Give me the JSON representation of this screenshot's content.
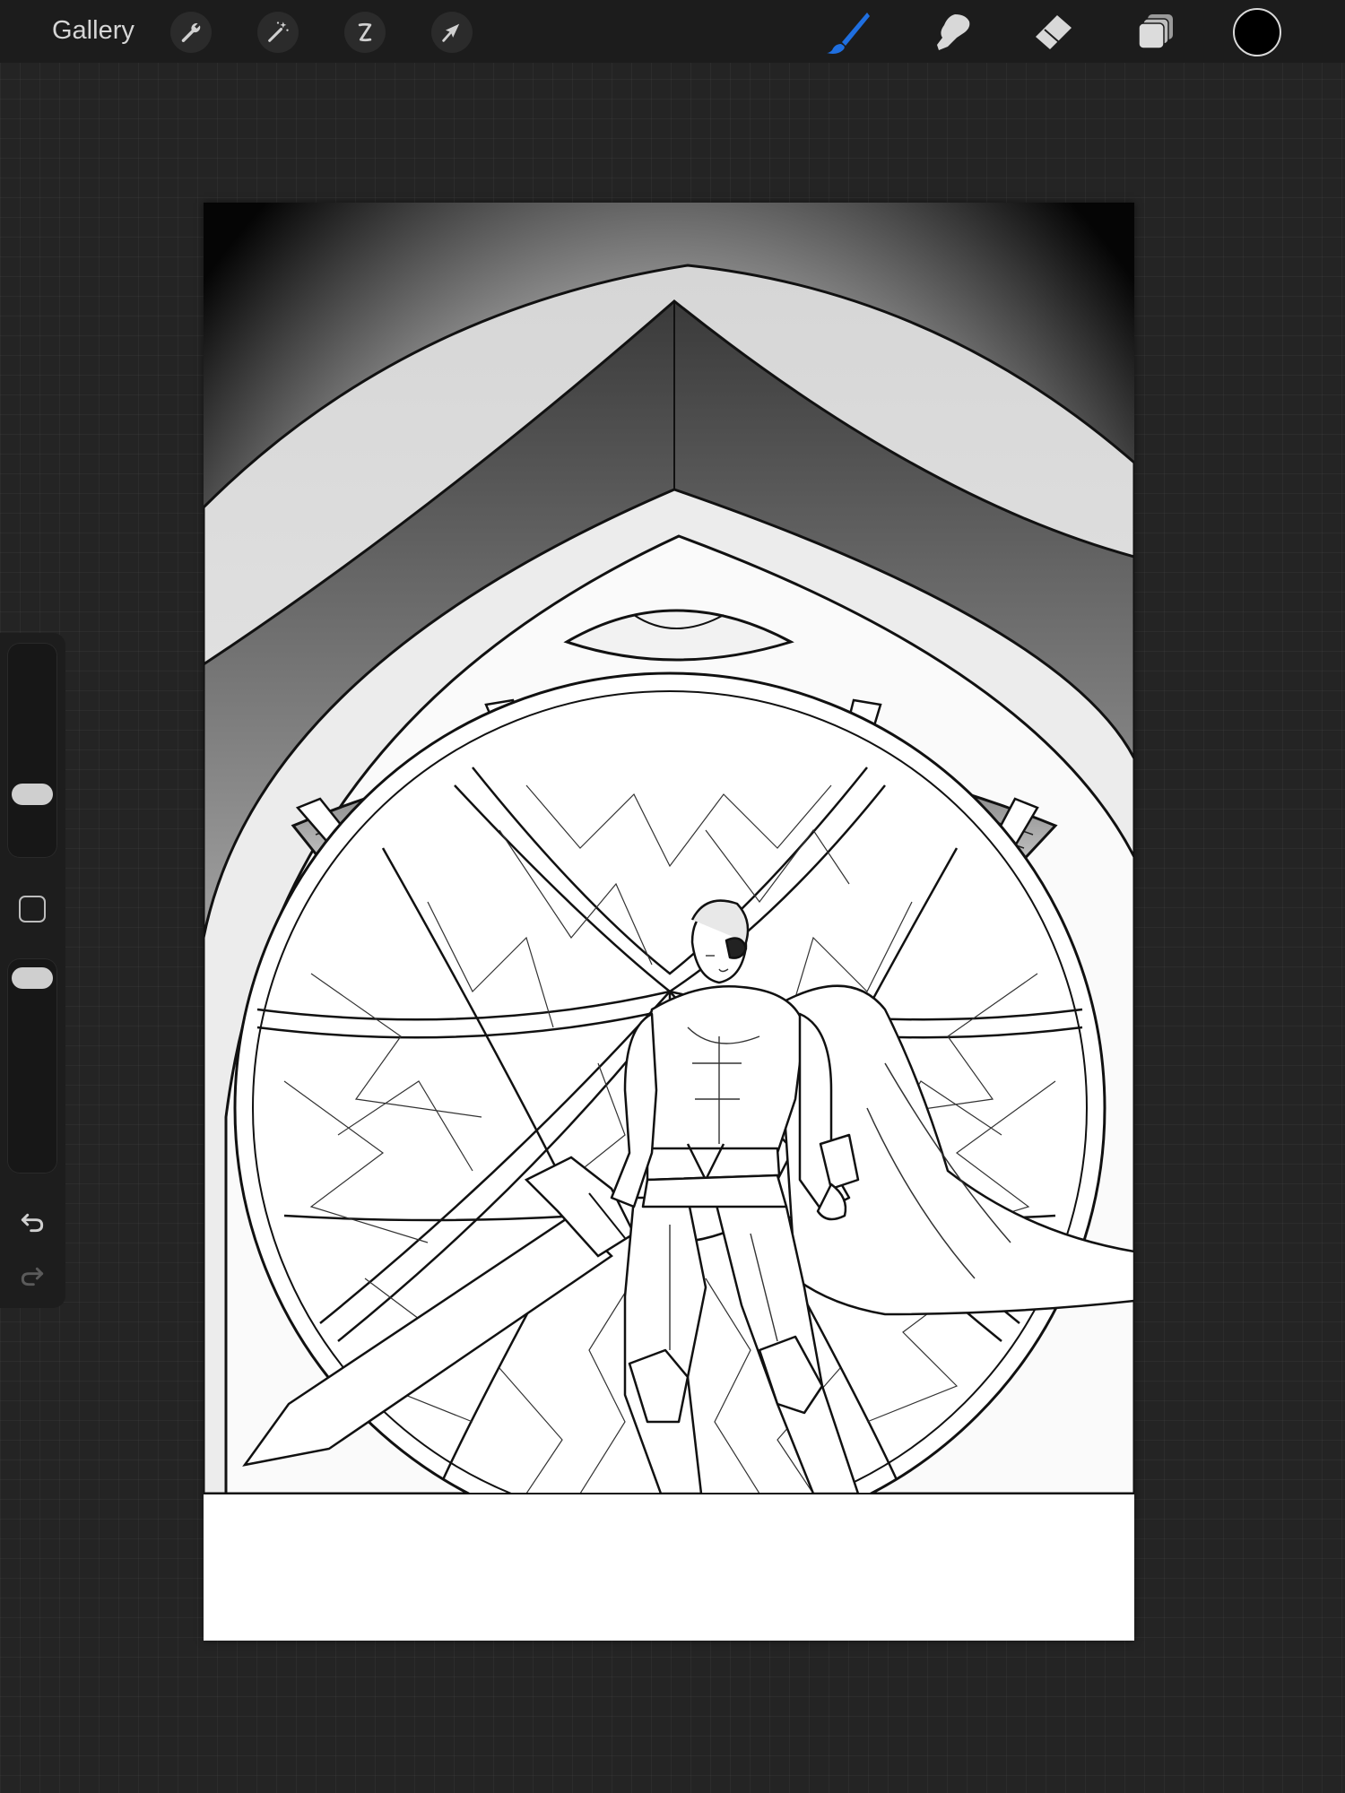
{
  "toolbar": {
    "gallery_label": "Gallery",
    "actions": [
      "wrench-icon",
      "magic-wand-icon",
      "selection-icon",
      "transform-arrow-icon"
    ],
    "tools": [
      "brush-icon",
      "smudge-icon",
      "eraser-icon",
      "layers-icon"
    ],
    "active_tool": "brush",
    "active_color": "#000000",
    "accent_color": "#1f6fe0"
  },
  "sidebar": {
    "brush_size_level": 0.55,
    "opacity_level": 0.0,
    "controls": [
      "brush-size-slider",
      "modify-button",
      "opacity-slider",
      "undo-icon",
      "redo-icon"
    ]
  },
  "canvas": {
    "background": "#ffffff",
    "artwork": "line-art-illustration"
  }
}
